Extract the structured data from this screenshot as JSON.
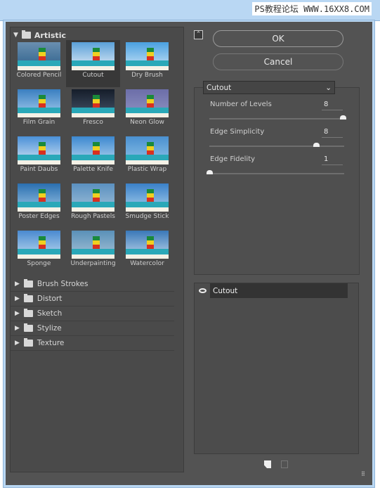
{
  "watermark": "PS教程论坛 WWW.16XX8.COM",
  "gallery": {
    "open_category": "Artistic",
    "filters": [
      {
        "label": "Colored Pencil",
        "selected": false
      },
      {
        "label": "Cutout",
        "selected": true
      },
      {
        "label": "Dry Brush",
        "selected": false
      },
      {
        "label": "Film Grain",
        "selected": false
      },
      {
        "label": "Fresco",
        "selected": false
      },
      {
        "label": "Neon Glow",
        "selected": false
      },
      {
        "label": "Paint Daubs",
        "selected": false
      },
      {
        "label": "Palette Knife",
        "selected": false
      },
      {
        "label": "Plastic Wrap",
        "selected": false
      },
      {
        "label": "Poster Edges",
        "selected": false
      },
      {
        "label": "Rough Pastels",
        "selected": false
      },
      {
        "label": "Smudge Stick",
        "selected": false
      },
      {
        "label": "Sponge",
        "selected": false
      },
      {
        "label": "Underpainting",
        "selected": false
      },
      {
        "label": "Watercolor",
        "selected": false
      }
    ],
    "categories": [
      "Brush Strokes",
      "Distort",
      "Sketch",
      "Stylize",
      "Texture"
    ]
  },
  "buttons": {
    "ok": "OK",
    "cancel": "Cancel"
  },
  "settings": {
    "filter_select": "Cutout",
    "params": [
      {
        "label": "Number of Levels",
        "value": "8",
        "min": 2,
        "max": 8
      },
      {
        "label": "Edge Simplicity",
        "value": "8",
        "min": 0,
        "max": 10
      },
      {
        "label": "Edge Fidelity",
        "value": "1",
        "min": 1,
        "max": 3
      }
    ]
  },
  "layers": [
    {
      "name": "Cutout",
      "visible": true
    }
  ]
}
